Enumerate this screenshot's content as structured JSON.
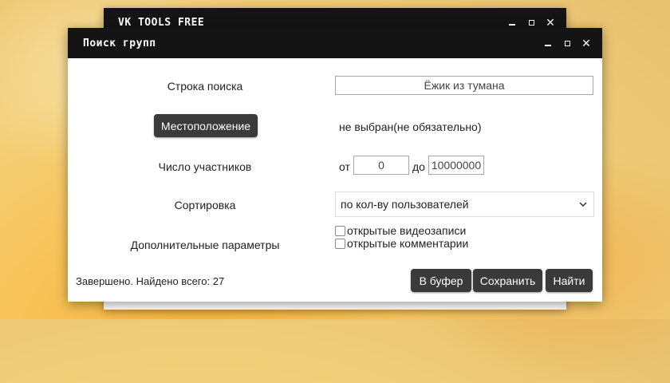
{
  "back_window": {
    "title": "VK TOOLS FREE"
  },
  "window": {
    "title": "Поиск групп",
    "search": {
      "label": "Строка поиска",
      "value": "Ёжик из тумана"
    },
    "location": {
      "button_label": "Местоположение",
      "value": "не выбран(не обязательно)"
    },
    "members": {
      "label": "Число участников",
      "from_label": "от",
      "from_value": "0",
      "to_label": "до",
      "to_value": "10000000"
    },
    "sort": {
      "label": "Сортировка",
      "selected": "по кол-ву пользователей"
    },
    "extra": {
      "label": "Дополнительные параметры",
      "options": [
        {
          "label": "открытые видеозаписи",
          "checked": false
        },
        {
          "label": "открытые комментарии",
          "checked": false
        }
      ]
    },
    "status": "Завершено. Найдено всего: 27",
    "buttons": {
      "buffer": "В буфер",
      "save": "Сохранить",
      "find": "Найти"
    }
  }
}
